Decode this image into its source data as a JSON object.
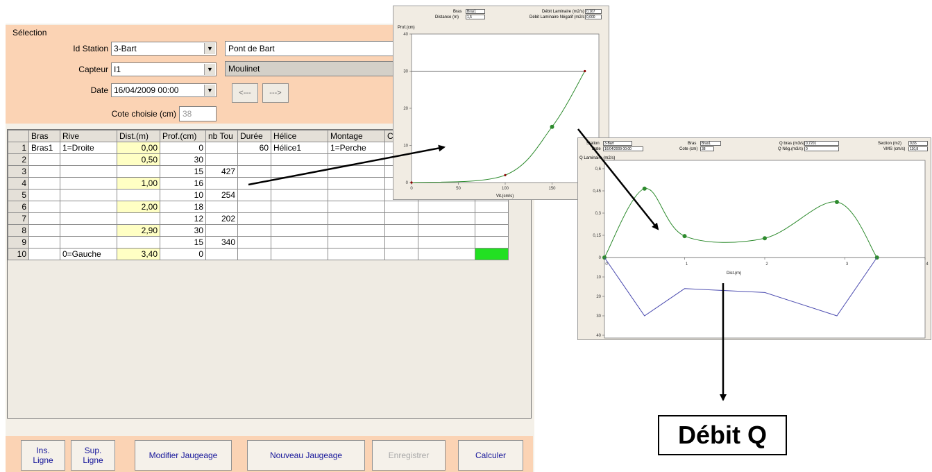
{
  "selection": {
    "group_label": "Sélection",
    "station_label": "Id Station",
    "station_value": "3-Bart",
    "station_name": "Pont de Bart",
    "capteur_label": "Capteur",
    "capteur_value": "I1",
    "capteur_name": "Moulinet",
    "date_label": "Date",
    "date_value": "16/04/2009 00:00",
    "prev_label": "<---",
    "next_label": "--->",
    "cote_label": "Cote choisie (cm)",
    "cote_value": "38"
  },
  "grid": {
    "columns": [
      "",
      "Bras",
      "Rive",
      "Dist.(m)",
      "Prof.(cm)",
      "nb Tou",
      "Durée",
      "Hélice",
      "Montage",
      "C",
      "",
      ""
    ],
    "rows": [
      {
        "n": "1",
        "bras": "Bras1",
        "rive": "1=Droite",
        "dist": "0,00",
        "prof": "0",
        "nb": "",
        "duree": "60",
        "helice": "Hélice1",
        "montage": "1=Perche"
      },
      {
        "n": "2",
        "bras": "",
        "rive": "",
        "dist": "0,50",
        "prof": "30",
        "nb": "",
        "duree": "",
        "helice": "",
        "montage": ""
      },
      {
        "n": "3",
        "bras": "",
        "rive": "",
        "dist": "",
        "prof": "15",
        "nb": "427",
        "duree": "",
        "helice": "",
        "montage": ""
      },
      {
        "n": "4",
        "bras": "",
        "rive": "",
        "dist": "1,00",
        "prof": "16",
        "nb": "",
        "duree": "",
        "helice": "",
        "montage": ""
      },
      {
        "n": "5",
        "bras": "",
        "rive": "",
        "dist": "",
        "prof": "10",
        "nb": "254",
        "duree": "",
        "helice": "",
        "montage": ""
      },
      {
        "n": "6",
        "bras": "",
        "rive": "",
        "dist": "2,00",
        "prof": "18",
        "nb": "",
        "duree": "",
        "helice": "",
        "montage": ""
      },
      {
        "n": "7",
        "bras": "",
        "rive": "",
        "dist": "",
        "prof": "12",
        "nb": "202",
        "duree": "",
        "helice": "",
        "montage": ""
      },
      {
        "n": "8",
        "bras": "",
        "rive": "",
        "dist": "2,90",
        "prof": "30",
        "nb": "",
        "duree": "",
        "helice": "",
        "montage": ""
      },
      {
        "n": "9",
        "bras": "",
        "rive": "",
        "dist": "",
        "prof": "15",
        "nb": "340",
        "duree": "",
        "helice": "",
        "montage": ""
      },
      {
        "n": "10",
        "bras": "",
        "rive": "0=Gauche",
        "dist": "3,40",
        "prof": "0",
        "nb": "",
        "duree": "",
        "helice": "",
        "montage": ""
      }
    ]
  },
  "buttons": {
    "ins_ligne": "Ins.\nLigne",
    "sup_ligne": "Sup.\nLigne",
    "modifier": "Modifier Jaugeage",
    "nouveau": "Nouveau Jaugeage",
    "enregistrer": "Enregistrer",
    "calculer": "Calculer"
  },
  "chart1_header": {
    "bras_label": "Bras",
    "bras_value": "Bras1",
    "distance_label": "Distance (m)",
    "distance_value": "1,5",
    "debit_lam_label": "Débit Laminaire (m2/s)",
    "debit_lam_value": "0,167",
    "debit_neg_label": "Débit Laminaire Négatif (m2/s)",
    "debit_neg_value": "0,000",
    "ylabel": "Prof.(cm)",
    "xlabel": "Vit.(cm/s)"
  },
  "chart2_header": {
    "station_label": "Station",
    "station_value": "3-Bart",
    "date_label": "Date",
    "date_value": "16/04/2009 00:00",
    "bras_label": "Bras",
    "bras_value": "Bras1",
    "cote_label": "Cote (cm)",
    "cote_value": "38",
    "qbras_label": "Q bras (m3/s)",
    "qbras_value": "0,7201",
    "qneg_label": "Q Nég.(m3/s)",
    "qneg_value": "0",
    "section_label": "Section (m2)",
    "section_value": "0,65",
    "vms_label": "VMS (cm/s)",
    "vms_value": "110,8",
    "ylabel": "Q Laminaire (m2/s)",
    "xlabel": "Dist.(m)"
  },
  "debit_label": "Débit Q",
  "chart_data": [
    {
      "type": "line",
      "xlabel": "Vit.(cm/s)",
      "ylabel": "Prof.(cm)",
      "xlim": [
        0,
        200
      ],
      "ylim": [
        0,
        40
      ],
      "x_ticks": [
        "0",
        "50",
        "100",
        "150"
      ],
      "y_ticks": [
        "0",
        "10",
        "20",
        "30",
        "40"
      ],
      "series": [
        {
          "color": "#2e8b2e",
          "x": [
            0,
            100,
            150,
            185
          ],
          "y": [
            0,
            2,
            15,
            30
          ]
        },
        {
          "color": "#333333",
          "x": [
            0,
            185
          ],
          "y": [
            30,
            30
          ]
        }
      ],
      "points": [
        {
          "x": 0,
          "y": 0
        },
        {
          "x": 150,
          "y": 15
        },
        {
          "x": 100,
          "y": 2
        },
        {
          "x": 185,
          "y": 30
        }
      ]
    },
    {
      "type": "line",
      "xlabel": "Dist.(m)",
      "ylabel": "Q Laminaire (m2/s)",
      "xlim": [
        0,
        4
      ],
      "ylim": [
        0,
        0.6
      ],
      "x_ticks": [
        "0",
        "1",
        "2",
        "3",
        "4"
      ],
      "y_ticks": [
        "0,6",
        "0,45",
        "0,3",
        "0,15",
        "0"
      ],
      "y2_ticks": [
        "10",
        "20",
        "30",
        "40"
      ],
      "series": [
        {
          "color": "#2e8b2e",
          "x": [
            0,
            0.5,
            1.0,
            2.0,
            2.9,
            3.4
          ],
          "y": [
            0,
            0.465,
            0.145,
            0.13,
            0.375,
            0
          ]
        },
        {
          "color": "#4c4cb0",
          "x": [
            0,
            0.5,
            1.0,
            2.0,
            2.9,
            3.4
          ],
          "y_depth": [
            0,
            30,
            16,
            18,
            30,
            0
          ]
        }
      ]
    }
  ]
}
